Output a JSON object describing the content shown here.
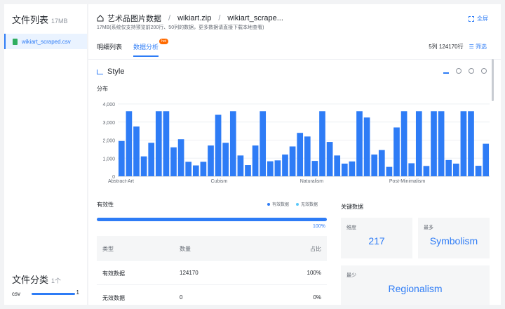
{
  "sidebar": {
    "title": "文件列表",
    "size": "17MB",
    "file": "wikiart_scraped.csv",
    "category_title": "文件分类",
    "category_count": "1个",
    "category_row": {
      "label": "csv",
      "count": "1"
    }
  },
  "header": {
    "crumbs": [
      "艺术品图片数据",
      "wikiart.zip",
      "wikiart_scrape..."
    ],
    "sub": "17MB(系统仅支持预览前200行、50列的数据，更多数据请直接下载本地查看)",
    "fullscreen": "全屏"
  },
  "tabs": [
    {
      "label": "明细列表"
    },
    {
      "label": "数据分析",
      "badge": "hot"
    }
  ],
  "rowinfo": {
    "dims": "5列 124170行",
    "filter": "筛选"
  },
  "column": {
    "name": "Style",
    "dist_label": "分布"
  },
  "chart_data": {
    "type": "bar",
    "ylim": [
      0,
      4000
    ],
    "yticks": [
      "0",
      "1,000",
      "2,000",
      "3,000",
      "4,000"
    ],
    "xlabels": [
      {
        "index": 0,
        "text": "Abstract-Art"
      },
      {
        "index": 12,
        "text": "Cubism"
      },
      {
        "index": 24,
        "text": "Naturalism"
      },
      {
        "index": 36,
        "text": "Post-Minimalism"
      }
    ],
    "values": [
      1950,
      3600,
      2750,
      1100,
      1850,
      3600,
      3600,
      1600,
      2050,
      800,
      600,
      800,
      1700,
      3400,
      1850,
      3600,
      1150,
      620,
      1700,
      3600,
      830,
      880,
      1200,
      1650,
      2400,
      2200,
      850,
      3600,
      1900,
      1150,
      700,
      820,
      3600,
      3250,
      1200,
      1450,
      520,
      2700,
      3600,
      720,
      3600,
      570,
      3600,
      3600,
      900,
      700,
      3600,
      3600,
      580,
      1800
    ]
  },
  "validity": {
    "title": "有效性",
    "legend_valid": "有效数据",
    "legend_invalid": "无效数据",
    "percent": "100%",
    "valid_fraction": 1.0,
    "colors": {
      "valid": "#2e7cf6",
      "invalid": "#5ac8fa"
    },
    "table": {
      "headers": [
        "类型",
        "数量",
        "占比"
      ],
      "rows": [
        [
          "有效数据",
          "124170",
          "100%"
        ],
        [
          "无效数据",
          "0",
          "0%"
        ]
      ]
    }
  },
  "key_data": {
    "title": "关键数据",
    "cards": [
      {
        "label": "维度",
        "value": "217"
      },
      {
        "label": "最多",
        "value": "Symbolism"
      },
      {
        "label": "最少",
        "value": "Regionalism"
      }
    ]
  }
}
